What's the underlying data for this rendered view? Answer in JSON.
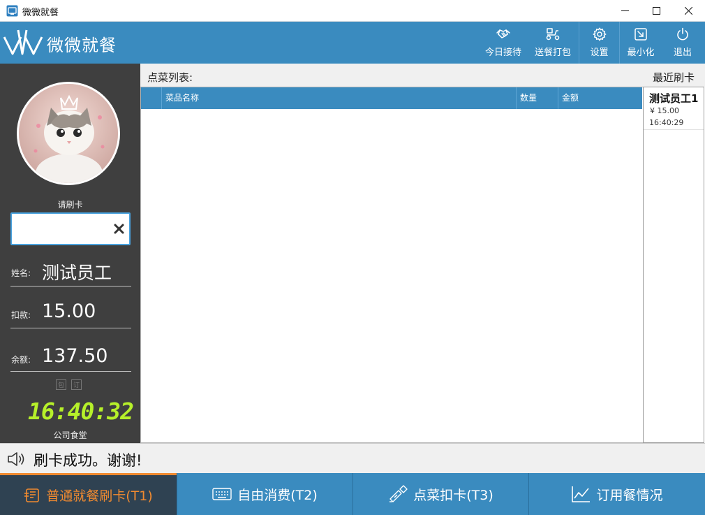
{
  "window": {
    "title": "微微就餐"
  },
  "header": {
    "app_name": "微微就餐",
    "buttons": [
      {
        "label": "今日接待",
        "icon": "handshake-icon"
      },
      {
        "label": "送餐打包",
        "icon": "delivery-scooter-icon"
      },
      {
        "label": "设置",
        "icon": "gear-icon"
      },
      {
        "label": "最小化",
        "icon": "minimize-arrow-icon"
      },
      {
        "label": "退出",
        "icon": "power-icon"
      }
    ]
  },
  "sidebar": {
    "swipe_prompt": "请刷卡",
    "card_input": {
      "value": "",
      "placeholder": ""
    },
    "name_label": "姓名:",
    "name_value": "测试员工",
    "deduct_label": "扣款:",
    "deduct_value": "15.00",
    "balance_label": "余额:",
    "balance_value": "137.50",
    "mini_boxes": [
      "包",
      "订"
    ],
    "clock": "16:40:32",
    "canteen": "公司食堂"
  },
  "main": {
    "list_title": "点菜列表:",
    "columns": [
      "菜品名称",
      "数量",
      "金额"
    ],
    "rows": []
  },
  "recent": {
    "title": "最近刷卡",
    "items": [
      {
        "name": "测试员工1",
        "amount": "¥ 15.00",
        "time": "16:40:29"
      }
    ]
  },
  "status": {
    "message": "刷卡成功。谢谢!"
  },
  "tabs": [
    {
      "label": "普通就餐刷卡(T1)",
      "icon": "card-reader-icon",
      "active": true
    },
    {
      "label": "自由消费(T2)",
      "icon": "keyboard-icon",
      "active": false
    },
    {
      "label": "点菜扣卡(T3)",
      "icon": "pen-card-icon",
      "active": false
    },
    {
      "label": "订用餐情况",
      "icon": "line-chart-icon",
      "active": false
    }
  ],
  "colors": {
    "primary": "#3a8bbf",
    "sidebar": "#3f3f3f",
    "active_tab": "#2f4252",
    "active_accent": "#f08a30",
    "clock": "#b6f02a"
  }
}
